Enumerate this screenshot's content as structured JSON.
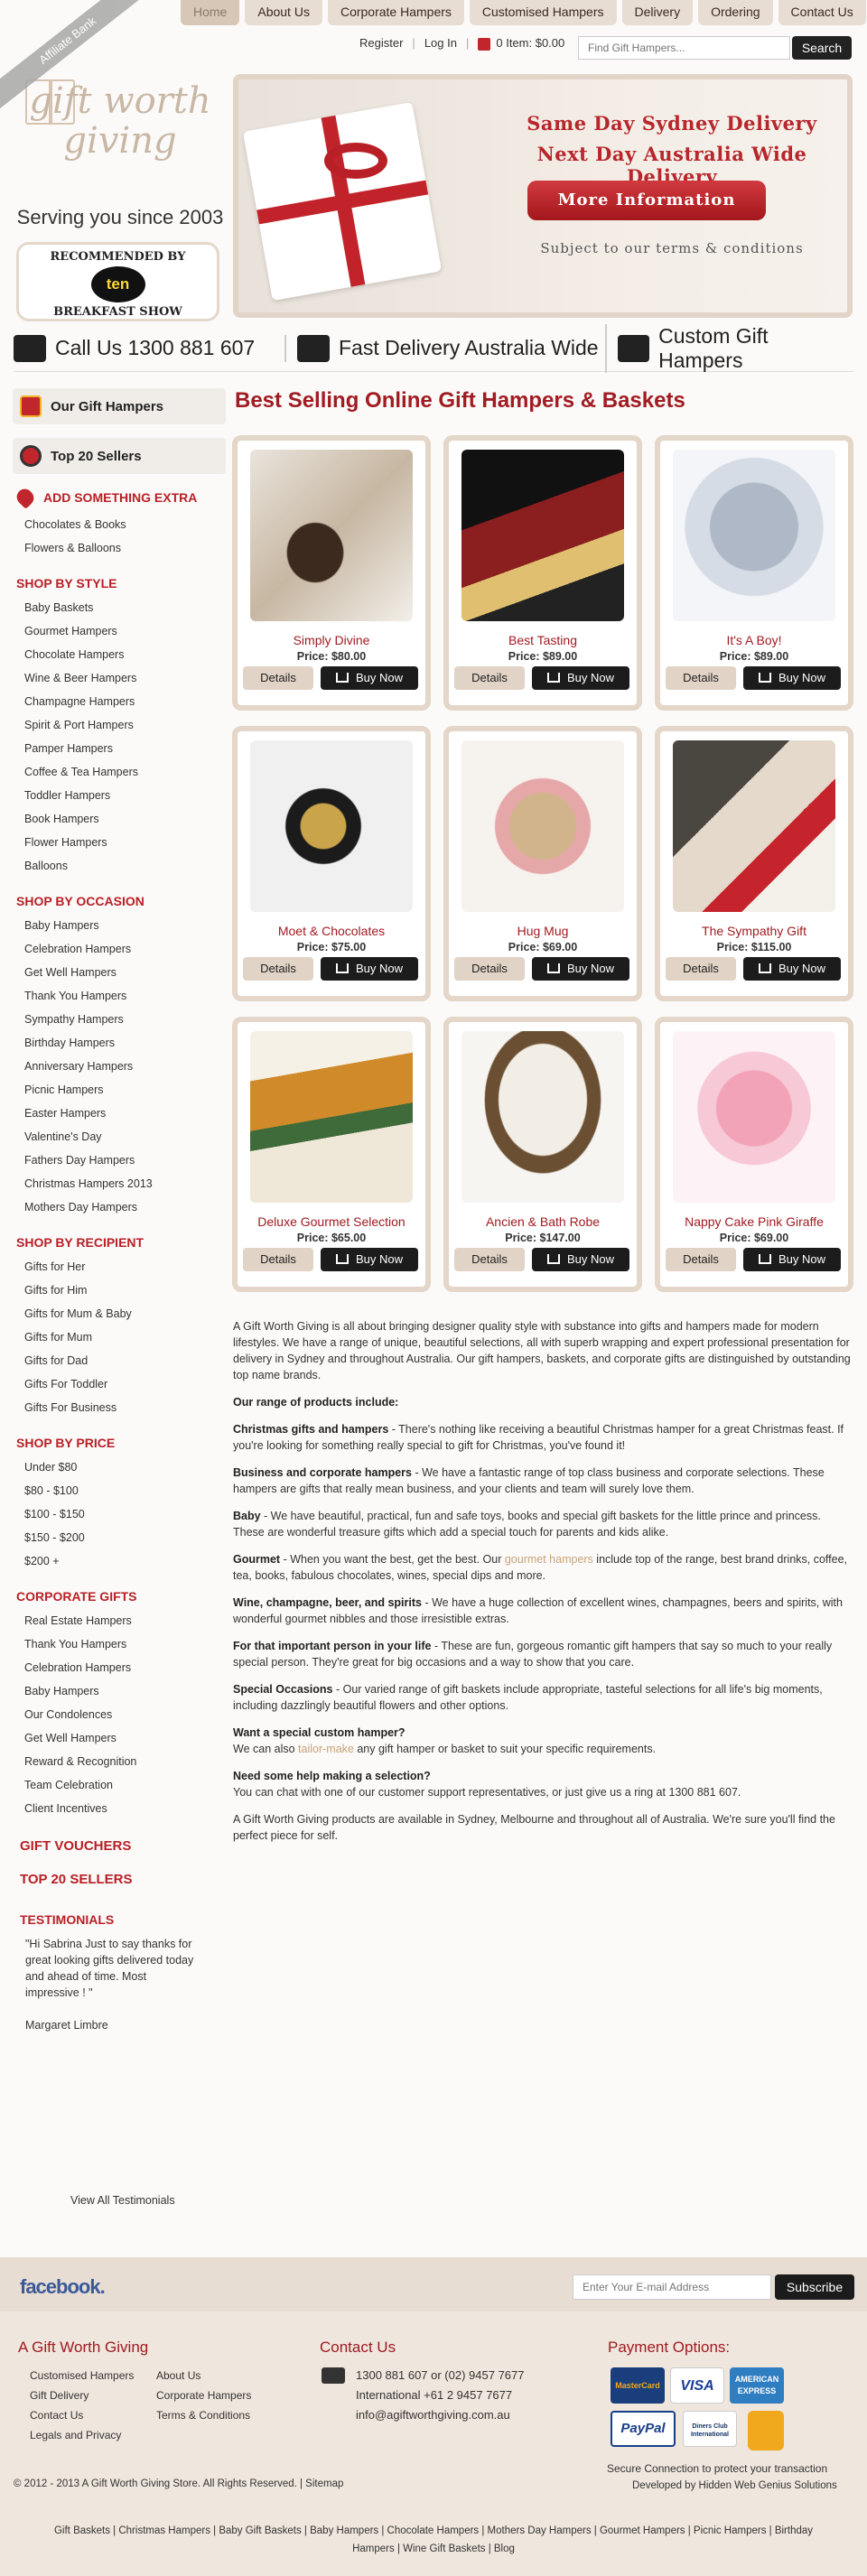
{
  "nav": [
    "Home",
    "About Us",
    "Corporate Hampers",
    "Customised Hampers",
    "Delivery",
    "Ordering",
    "Contact Us"
  ],
  "util": {
    "register": "Register",
    "login": "Log In",
    "cart": "0 Item: $0.00",
    "search_placeholder": "Find Gift Hampers...",
    "search_button": "Search"
  },
  "logo": {
    "ribbon": "Affiliate Bank",
    "text": "gift worth giving",
    "tagline": "Serving you since 2003",
    "rec_top": "RECOMMENDED BY",
    "rec_mid": "ten",
    "rec_bottom": "BREAKFAST SHOW"
  },
  "banner": {
    "line1": "Same Day Sydney Delivery",
    "line2": "Next Day Australia Wide Delivery",
    "button": "More Information",
    "line3": "Subject to our terms & conditions"
  },
  "features": [
    "Call Us 1300 881 607",
    "Fast Delivery Australia Wide",
    "Custom Gift Hampers"
  ],
  "sidebar": {
    "tab1": "Our Gift Hampers",
    "tab2": "Top 20 Sellers",
    "extra": "ADD SOMETHING EXTRA",
    "extra_items": [
      "Chocolates & Books",
      "Flowers & Balloons"
    ],
    "style_h": "SHOP BY STYLE",
    "style": [
      "Baby Baskets",
      "Gourmet Hampers",
      "Chocolate Hampers",
      "Wine & Beer Hampers",
      "Champagne Hampers",
      "Spirit & Port Hampers",
      "Pamper Hampers",
      "Coffee & Tea Hampers",
      "Toddler Hampers",
      "Book Hampers",
      "Flower Hampers",
      "Balloons"
    ],
    "occasion_h": "SHOP BY OCCASION",
    "occasion": [
      "Baby Hampers",
      "Celebration Hampers",
      "Get Well Hampers",
      "Thank You Hampers",
      "Sympathy Hampers",
      "Birthday Hampers",
      "Anniversary Hampers",
      "Picnic Hampers",
      "Easter Hampers",
      "Valentine's Day",
      "Fathers Day Hampers",
      "Christmas Hampers 2013",
      "Mothers Day Hampers"
    ],
    "recipient_h": "SHOP BY RECIPIENT",
    "recipient": [
      "Gifts for Her",
      "Gifts for Him",
      "Gifts for Mum & Baby",
      "Gifts for Mum",
      "Gifts for Dad",
      "Gifts For Toddler",
      "Gifts For Business"
    ],
    "price_h": "SHOP BY PRICE",
    "price": [
      "Under $80",
      "$80 - $100",
      "$100 - $150",
      "$150 - $200",
      "$200 +"
    ],
    "corporate_h": "CORPORATE GIFTS",
    "corporate": [
      "Real Estate Hampers",
      "Thank You Hampers",
      "Celebration Hampers",
      "Baby Hampers",
      "Our Condolences",
      "Get Well Hampers",
      "Reward & Recognition",
      "Team Celebration",
      "Client Incentives"
    ],
    "vouchers": "GIFT VOUCHERS",
    "top20": "TOP 20 SELLERS",
    "testi_h": "TESTIMONIALS",
    "testi_q": "\"Hi Sabrina Just to say thanks for great looking gifts delivered today and ahead of time. Most impressive ! \"",
    "testi_a": "Margaret Limbre",
    "view_all": "View All Testimonials"
  },
  "main_heading": "Best Selling Online Gift Hampers & Baskets",
  "products": [
    {
      "name": "Simply Divine",
      "price": "Price: $80.00"
    },
    {
      "name": "Best Tasting",
      "price": "Price: $89.00"
    },
    {
      "name": "It's A Boy!",
      "price": "Price: $89.00"
    },
    {
      "name": "Moet & Chocolates",
      "price": "Price: $75.00"
    },
    {
      "name": "Hug Mug",
      "price": "Price: $69.00"
    },
    {
      "name": "The Sympathy Gift",
      "price": "Price: $115.00"
    },
    {
      "name": "Deluxe Gourmet Selection",
      "price": "Price: $65.00"
    },
    {
      "name": "Ancien & Bath Robe",
      "price": "Price: $147.00"
    },
    {
      "name": "Nappy Cake Pink Giraffe",
      "price": "Price: $69.00"
    }
  ],
  "btn_details": "Details",
  "btn_buy": "Buy Now",
  "desc": {
    "intro": "A Gift Worth Giving is all about bringing designer quality style with substance into gifts and hampers made for modern lifestyles. We have a range of unique, beautiful selections, all with superb wrapping and expert professional presentation for delivery in Sydney and throughout Australia. Our gift hampers, baskets, and corporate gifts are distinguished by outstanding top name brands.",
    "range_h": "Our range of products include:",
    "xmas_b": "Christmas gifts and hampers",
    "xmas": " - There's nothing like receiving a beautiful Christmas hamper for a great Christmas feast. If you're looking for something really special to gift for Christmas, you've found it!",
    "biz_b": "Business and corporate hampers",
    "biz": " - We have a fantastic range of top class business and corporate selections. These hampers are gifts that really mean business, and your clients and team will surely love them.",
    "baby_b": "Baby",
    "baby": " - We have beautiful, practical, fun and safe toys, books and special gift baskets for the little prince and princess. These are wonderful treasure gifts which add a special touch for parents and kids alike.",
    "gourmet_b": "Gourmet",
    "gourmet1": " - When you want the best, get the best. Our ",
    "gourmet_link": "gourmet hampers",
    "gourmet2": " include top of the range, best brand drinks, coffee, tea, books, fabulous chocolates, wines, special dips and more.",
    "wine_b": "Wine, champagne, beer, and spirits ",
    "wine": " - We have a huge collection of excellent wines, champagnes, beers and spirits, with wonderful gourmet nibbles and those irresistible extras.",
    "person_b": "For that important person in your life",
    "person": " - These are fun, gorgeous romantic gift hampers that say so much to your really special person. They're great for big occasions and a way to show that you care.",
    "occ_b": "Special Occasions",
    "occ": " - Our varied range of gift baskets include appropriate, tasteful selections for all life's big moments, including dazzlingly beautiful flowers and other options.",
    "custom_h": "Want a special custom hamper?",
    "custom1": "We can also ",
    "custom_link": "tailor-make",
    "custom2": " any gift hamper or basket to suit your specific requirements.",
    "help_h": "Need some help making a selection?",
    "help": "You can chat with one of our customer support representatives, or just give us a ring at 1300 881 607.",
    "outro": "A Gift Worth Giving products are available in Sydney, Melbourne and throughout all of Australia. We're sure you'll find the perfect piece for self."
  },
  "footer": {
    "facebook": "facebook.",
    "email_placeholder": "Enter Your E-mail Address",
    "subscribe": "Subscribe",
    "col1_h": "A Gift Worth Giving",
    "col1a": [
      "Customised Hampers",
      "Gift Delivery",
      "Contact Us",
      "Legals and Privacy"
    ],
    "col1b": [
      "About Us",
      "Corporate Hampers",
      "Terms & Conditions"
    ],
    "col2_h": "Contact Us",
    "phone": "1300 881 607 or (02) 9457 7677",
    "intl": "International +61 2 9457 7677",
    "mail": "info@agiftworthgiving.com.au",
    "col3_h": "Payment Options:",
    "pay": [
      "MasterCard",
      "VISA",
      "AMERICAN EXPRESS",
      "PayPal",
      "Diners Club International"
    ],
    "secure": "Secure Connection to protect your transaction",
    "copy": "© 2012 - 2013 A Gift Worth Giving Store. All Rights Reserved. | Sitemap",
    "dev": "Developed by Hidden Web Genius Solutions",
    "links": "Gift Baskets | Christmas Hampers | Baby Gift Baskets | Baby Hampers | Chocolate Hampers | Mothers Day Hampers | Gourmet Hampers | Picnic Hampers | Birthday Hampers | Wine Gift Baskets | Blog"
  }
}
